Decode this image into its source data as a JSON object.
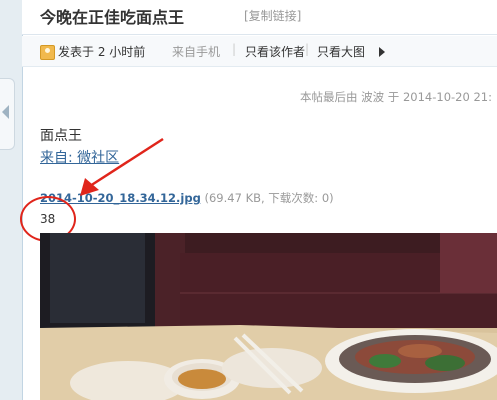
{
  "thread": {
    "title": "今晚在正佳吃面点王",
    "copy_link": "[复制链接]"
  },
  "meta": {
    "posted": "发表于 2 小时前",
    "via": "来自手机",
    "separator": "|",
    "only_author": "只看该作者",
    "only_large": "只看大图"
  },
  "last_edit": "本帖最后由 波波 于 2014-10-20 21:",
  "post": {
    "title": "面点王",
    "source": "来自: 微社区"
  },
  "attachment": {
    "filename": "2014-10-20_18.34.12.jpg",
    "info": "(69.47 KB, 下载次数: 0)",
    "views": "38"
  },
  "icons": [
    "user-icon",
    "triangle-right-icon",
    "collapse-arrow-icon"
  ],
  "colors": {
    "link": "#336699",
    "annotation": "#e0251b",
    "meta_bg": "#f7f9fb"
  }
}
